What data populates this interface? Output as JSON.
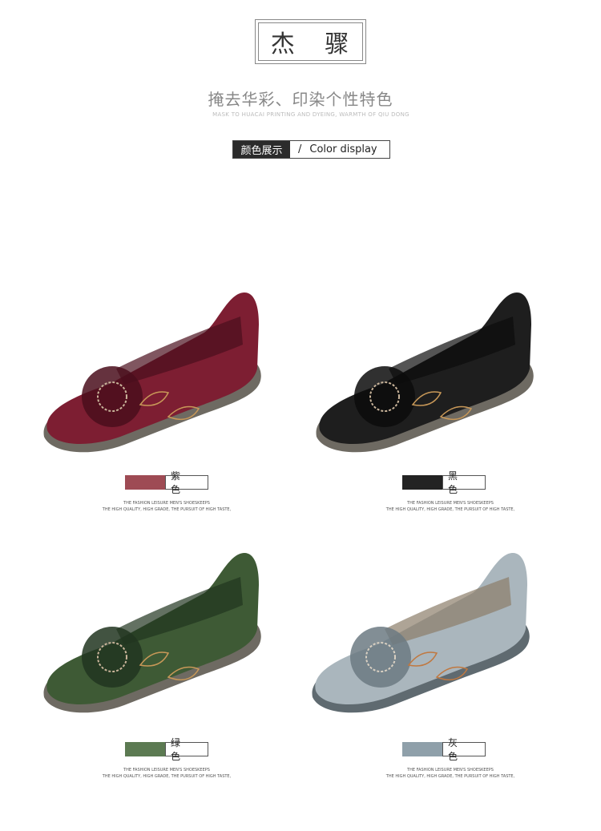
{
  "header": {
    "brand": "杰 骤",
    "slogan": "掩去华彩、印染个性特色",
    "slogan_en": "MASK TO HUACAI PRINTING AND DYEING, WARMTH OF QIU DONG"
  },
  "section": {
    "label_zh": "颜色展示",
    "separator": "/",
    "label_en": "Color display"
  },
  "products": [
    {
      "color_name": "紫 色",
      "swatch": "#9e4b54",
      "shoe_color": "#7d1e32",
      "shoe_dark": "#4a0e1c",
      "caption1": "THE FASHION LEISURE MEN'S SHOESKEEPS",
      "caption2": "THE HIGH QUALITY, HIGH GRADE, THE PURSUIT OF HIGH TASTE,"
    },
    {
      "color_name": "黑 色",
      "swatch": "#232323",
      "shoe_color": "#1e1e1e",
      "shoe_dark": "#0c0c0c",
      "caption1": "THE FASHION LEISURE MEN'S SHOESKEEPS",
      "caption2": "THE HIGH QUALITY, HIGH GRADE, THE PURSUIT OF HIGH TASTE,"
    },
    {
      "color_name": "绿 色",
      "swatch": "#5c7a52",
      "shoe_color": "#3e5a35",
      "shoe_dark": "#213520",
      "caption1": "THE FASHION LEISURE MEN'S SHOESKEEPS",
      "caption2": "THE HIGH QUALITY, HIGH GRADE, THE PURSUIT OF HIGH TASTE,"
    },
    {
      "color_name": "灰 色",
      "swatch": "#8fa0aa",
      "shoe_color": "#aab6bd",
      "shoe_dark": "#6c7a82",
      "caption1": "THE FASHION LEISURE MEN'S SHOESKEEPS",
      "caption2": "THE HIGH QUALITY, HIGH GRADE, THE PURSUIT OF HIGH TASTE,"
    }
  ]
}
